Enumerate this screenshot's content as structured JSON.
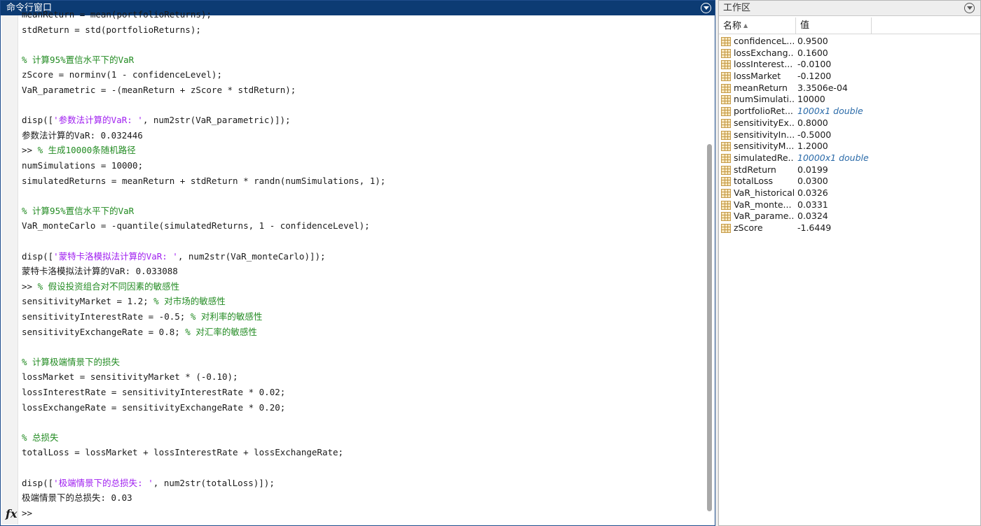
{
  "command_window": {
    "title": "命令行窗口",
    "fx_label": "fx",
    "lines": [
      [
        {
          "t": "meanReturn = mean(portfolioReturns);",
          "c": ""
        }
      ],
      [
        {
          "t": "stdReturn = std(portfolioReturns);",
          "c": ""
        }
      ],
      [],
      [
        {
          "t": "% 计算95%置信水平下的VaR",
          "c": "comment"
        }
      ],
      [
        {
          "t": "zScore = norminv(1 - confidenceLevel);",
          "c": ""
        }
      ],
      [
        {
          "t": "VaR_parametric = -(meanReturn + zScore * stdReturn);",
          "c": ""
        }
      ],
      [],
      [
        {
          "t": "disp([",
          "c": ""
        },
        {
          "t": "'参数法计算的VaR: '",
          "c": "string"
        },
        {
          "t": ", num2str(VaR_parametric)]);",
          "c": ""
        }
      ],
      [
        {
          "t": "参数法计算的VaR: 0.032446",
          "c": ""
        }
      ],
      [
        {
          "t": ">> ",
          "c": ""
        },
        {
          "t": "% 生成10000条随机路径",
          "c": "comment"
        }
      ],
      [
        {
          "t": "numSimulations = 10000;",
          "c": ""
        }
      ],
      [
        {
          "t": "simulatedReturns = meanReturn + stdReturn * randn(numSimulations, 1);",
          "c": ""
        }
      ],
      [],
      [
        {
          "t": "% 计算95%置信水平下的VaR",
          "c": "comment"
        }
      ],
      [
        {
          "t": "VaR_monteCarlo = -quantile(simulatedReturns, 1 - confidenceLevel);",
          "c": ""
        }
      ],
      [],
      [
        {
          "t": "disp([",
          "c": ""
        },
        {
          "t": "'蒙特卡洛模拟法计算的VaR: '",
          "c": "string"
        },
        {
          "t": ", num2str(VaR_monteCarlo)]);",
          "c": ""
        }
      ],
      [
        {
          "t": "蒙特卡洛模拟法计算的VaR: 0.033088",
          "c": ""
        }
      ],
      [
        {
          "t": ">> ",
          "c": ""
        },
        {
          "t": "% 假设投资组合对不同因素的敏感性",
          "c": "comment"
        }
      ],
      [
        {
          "t": "sensitivityMarket = 1.2; ",
          "c": ""
        },
        {
          "t": "% 对市场的敏感性",
          "c": "comment"
        }
      ],
      [
        {
          "t": "sensitivityInterestRate = -0.5; ",
          "c": ""
        },
        {
          "t": "% 对利率的敏感性",
          "c": "comment"
        }
      ],
      [
        {
          "t": "sensitivityExchangeRate = 0.8; ",
          "c": ""
        },
        {
          "t": "% 对汇率的敏感性",
          "c": "comment"
        }
      ],
      [],
      [
        {
          "t": "% 计算极端情景下的损失",
          "c": "comment"
        }
      ],
      [
        {
          "t": "lossMarket = sensitivityMarket * (-0.10);",
          "c": ""
        }
      ],
      [
        {
          "t": "lossInterestRate = sensitivityInterestRate * 0.02;",
          "c": ""
        }
      ],
      [
        {
          "t": "lossExchangeRate = sensitivityExchangeRate * 0.20;",
          "c": ""
        }
      ],
      [],
      [
        {
          "t": "% 总损失",
          "c": "comment"
        }
      ],
      [
        {
          "t": "totalLoss = lossMarket + lossInterestRate + lossExchangeRate;",
          "c": ""
        }
      ],
      [],
      [
        {
          "t": "disp([",
          "c": ""
        },
        {
          "t": "'极端情景下的总损失: '",
          "c": "string"
        },
        {
          "t": ", num2str(totalLoss)]);",
          "c": ""
        }
      ],
      [
        {
          "t": "极端情景下的总损失: 0.03",
          "c": ""
        }
      ],
      [
        {
          "t": ">>",
          "c": ""
        }
      ]
    ]
  },
  "workspace": {
    "title": "工作区",
    "col_name": "名称",
    "col_value": "值",
    "variables": [
      {
        "name": "confidenceL...",
        "value": "0.9500",
        "italic": false
      },
      {
        "name": "lossExchang...",
        "value": "0.1600",
        "italic": false
      },
      {
        "name": "lossInterest...",
        "value": "-0.0100",
        "italic": false
      },
      {
        "name": "lossMarket",
        "value": "-0.1200",
        "italic": false
      },
      {
        "name": "meanReturn",
        "value": "3.3506e-04",
        "italic": false
      },
      {
        "name": "numSimulati...",
        "value": "10000",
        "italic": false
      },
      {
        "name": "portfolioRet...",
        "value": "1000x1 double",
        "italic": true
      },
      {
        "name": "sensitivityEx...",
        "value": "0.8000",
        "italic": false
      },
      {
        "name": "sensitivityIn...",
        "value": "-0.5000",
        "italic": false
      },
      {
        "name": "sensitivityM...",
        "value": "1.2000",
        "italic": false
      },
      {
        "name": "simulatedRe...",
        "value": "10000x1 double",
        "italic": true
      },
      {
        "name": "stdReturn",
        "value": "0.0199",
        "italic": false
      },
      {
        "name": "totalLoss",
        "value": "0.0300",
        "italic": false
      },
      {
        "name": "VaR_historical",
        "value": "0.0326",
        "italic": false
      },
      {
        "name": "VaR_monte...",
        "value": "0.0331",
        "italic": false
      },
      {
        "name": "VaR_parame...",
        "value": "0.0324",
        "italic": false
      },
      {
        "name": "zScore",
        "value": "-1.6449",
        "italic": false
      }
    ]
  }
}
